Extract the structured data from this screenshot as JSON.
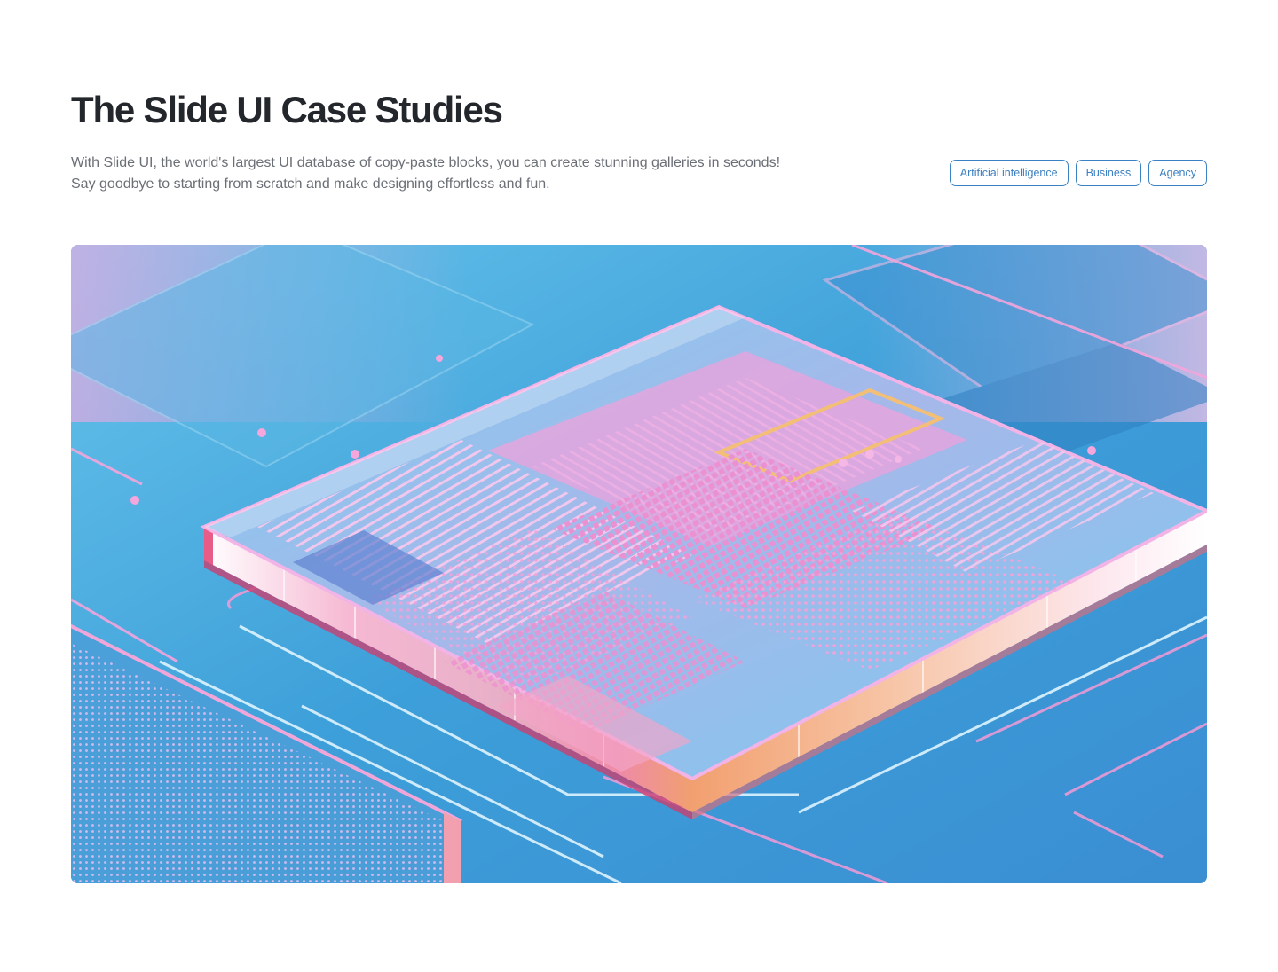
{
  "header": {
    "title": "The Slide UI Case Studies",
    "description_lines": [
      "With Slide UI, the world's largest UI database of copy-paste blocks, you can create stunning galleries in seconds!",
      "Say goodbye to starting from scratch and make designing effortless and fun."
    ]
  },
  "tags": [
    {
      "label": "Artificial intelligence"
    },
    {
      "label": "Business"
    },
    {
      "label": "Agency"
    }
  ],
  "hero": {
    "subject": "isometric microchip illustration",
    "colors": {
      "background": "#4aa7dc",
      "chip_pink": "#f29ad6",
      "chip_edge": "#e65a8f",
      "accent_orange": "#f5a06a",
      "line_light": "#dff3ff"
    }
  },
  "theme": {
    "title_color": "#23272b",
    "body_color": "#6b6f76",
    "tag_border": "#3b82c4",
    "tag_text": "#3b7fc0"
  }
}
